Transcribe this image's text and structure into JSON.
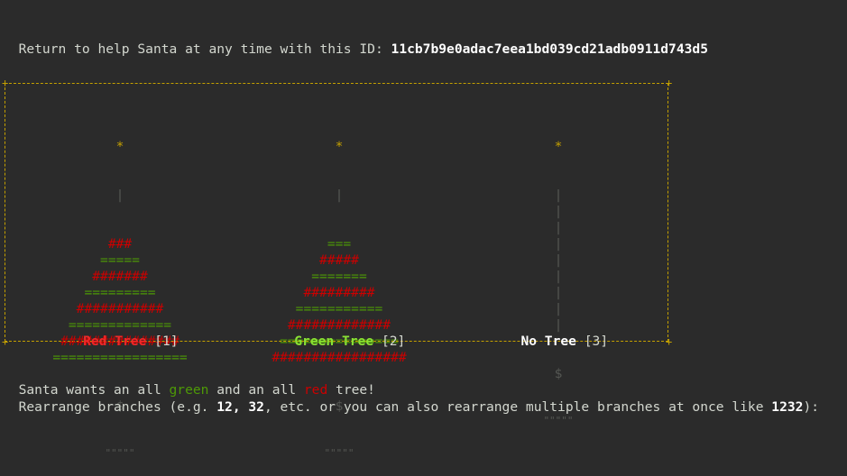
{
  "header": {
    "prompt": "Return to help Santa at any time with this ID: ",
    "session_id": "11cb7b9e0adac7eea1bd039cd21adb0911d743d5"
  },
  "trees": [
    {
      "name": "Red Tree",
      "index": "[1]",
      "name_color": "#ef2929",
      "star": "*",
      "trunk": "|",
      "base": "$",
      "roots": "\"\"\"\"\"",
      "branches": [
        {
          "text": "###",
          "color": "#cc0000"
        },
        {
          "text": "=====",
          "color": "#4e9a06"
        },
        {
          "text": "#######",
          "color": "#cc0000"
        },
        {
          "text": "=========",
          "color": "#4e9a06"
        },
        {
          "text": "###########",
          "color": "#cc0000"
        },
        {
          "text": "=============",
          "color": "#4e9a06"
        },
        {
          "text": "###############",
          "color": "#cc0000"
        },
        {
          "text": "=================",
          "color": "#4e9a06"
        }
      ]
    },
    {
      "name": "Green Tree",
      "index": "[2]",
      "name_color": "#8ae234",
      "star": "*",
      "trunk": "|",
      "base": "$",
      "roots": "\"\"\"\"\"",
      "branches": [
        {
          "text": "===",
          "color": "#4e9a06"
        },
        {
          "text": "#####",
          "color": "#cc0000"
        },
        {
          "text": "=======",
          "color": "#4e9a06"
        },
        {
          "text": "#########",
          "color": "#cc0000"
        },
        {
          "text": "===========",
          "color": "#4e9a06"
        },
        {
          "text": "#############",
          "color": "#cc0000"
        },
        {
          "text": "===============",
          "color": "#4e9a06"
        },
        {
          "text": "#################",
          "color": "#cc0000"
        }
      ]
    },
    {
      "name": "No Tree",
      "index": "[3]",
      "name_color": "#ffffff",
      "star": "*",
      "trunk": "|",
      "base": "$",
      "roots": "\"\"\"\"\"",
      "branches": []
    }
  ],
  "footer": {
    "goal_prefix": "Santa wants an all ",
    "goal_green": "green",
    "goal_middle": " and an all ",
    "goal_red": "red",
    "goal_suffix": " tree!",
    "instruction_prefix": "Rearrange branches (e.g. ",
    "example_1": "12",
    "sep_1": ", ",
    "example_2": "32",
    "instruction_mid": ", etc. or you can also rearrange multiple branches at once like ",
    "example_3": "1232",
    "instruction_suffix": "):"
  },
  "colors": {
    "background": "#2b2b2b",
    "border": "#c4a000",
    "star": "#c4a000",
    "trunk": "#555753"
  }
}
